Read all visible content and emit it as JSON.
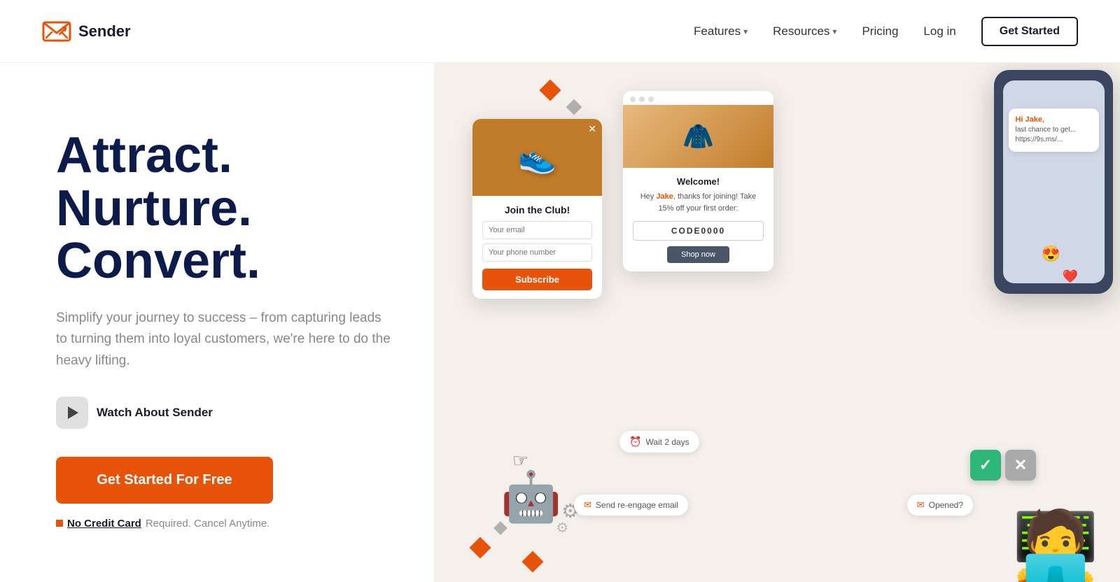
{
  "nav": {
    "logo_text": "Sender",
    "links": [
      {
        "id": "features",
        "label": "Features",
        "has_dropdown": true
      },
      {
        "id": "resources",
        "label": "Resources",
        "has_dropdown": true
      },
      {
        "id": "pricing",
        "label": "Pricing",
        "has_dropdown": false
      },
      {
        "id": "login",
        "label": "Log in",
        "has_dropdown": false
      }
    ],
    "cta_label": "Get Started"
  },
  "hero": {
    "headline": "Attract. Nurture. Convert.",
    "subtext": "Simplify your journey to success – from capturing leads to turning them into loyal customers, we're here to do the heavy lifting.",
    "watch_label": "Watch About Sender",
    "cta_label": "Get Started For Free",
    "no_credit_bold": "No Credit Card",
    "no_credit_rest": "Required. Cancel Anytime."
  },
  "popup": {
    "title": "Join the Club!",
    "email_placeholder": "Your email",
    "phone_placeholder": "Your phone number",
    "subscribe_label": "Subscribe"
  },
  "email_card": {
    "title": "Welcome!",
    "greeting": "Hey Jake, thanks for joining! Take 15% off your first order:",
    "code": "CODE0000",
    "shop_label": "Shop now"
  },
  "sms": {
    "hi": "Hi Jake,",
    "text": "last chance to get...\nhttps://9s.ms/..."
  },
  "workflow": {
    "wait_label": "Wait 2 days",
    "send_label": "Send re-engage email",
    "opened_label": "Opened?"
  }
}
